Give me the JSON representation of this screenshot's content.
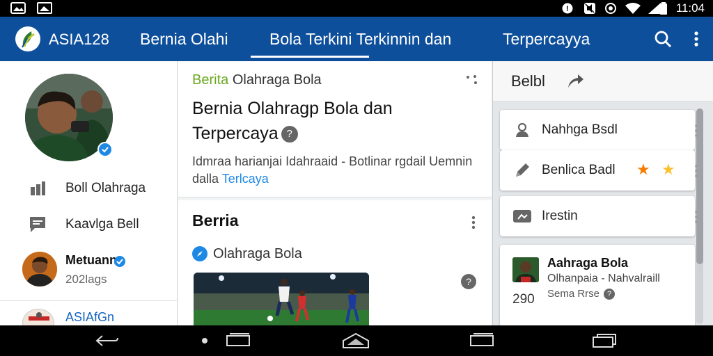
{
  "status_bar": {
    "time": "11:04",
    "left_icons": [
      "gallery-icon",
      "image-icon"
    ],
    "right_icons": [
      "alarm-icon",
      "mute-icon",
      "sync-icon",
      "wifi-icon",
      "signal-icon",
      "battery-icon"
    ]
  },
  "app_bar": {
    "brand": "ASIA128",
    "tabs": [
      {
        "label": "Bernia Olahi",
        "active": false
      },
      {
        "label": "Bola Terkini Terkinnin dan",
        "active": true
      },
      {
        "label": "Terpercayya",
        "active": false
      }
    ],
    "actions": [
      "search-icon",
      "more-vert-icon"
    ],
    "color": "#0e4f9c"
  },
  "sidebar": {
    "items": [
      {
        "label": "Boll Olahraga",
        "icon": "chart-icon"
      },
      {
        "label": "Kaavlga Bell",
        "icon": "message-icon"
      }
    ],
    "user": {
      "name": "Metuann",
      "sub": "202lags"
    },
    "bottom_label": "ASIAfGn"
  },
  "main": {
    "card1": {
      "category_highlight": "Berita",
      "category_rest": "Olahraga Bola",
      "title": "Bernia Olahragp Bola dan Terpercaya",
      "desc_text": "Idmraa harianjai Idahraaid - Botlinar rgdail Uemnin dalla",
      "desc_link": "Terlcaya"
    },
    "card2": {
      "heading": "Berria",
      "sub": "Olahraga Bola"
    }
  },
  "right_panel": {
    "header": "Belbl",
    "items": [
      {
        "label": "Nahhga Bsdl",
        "icon": "person-icon"
      },
      {
        "label": "Benlica Badl",
        "icon": "pencil-icon",
        "stars": [
          "#f57c00",
          "#fbc02d"
        ]
      },
      {
        "label": "Irestin",
        "icon": "media-icon"
      }
    ],
    "feature": {
      "title": "Aahraga Bola",
      "line2": "Olhanpaia - Nahvalraill",
      "line3": "Sema Rrse",
      "number": "290"
    }
  },
  "nav_bar": {
    "buttons": [
      "back-icon",
      "home-dot-icon",
      "recents-icon",
      "home-icon",
      "recents-alt-icon",
      "split-screen-icon"
    ]
  }
}
